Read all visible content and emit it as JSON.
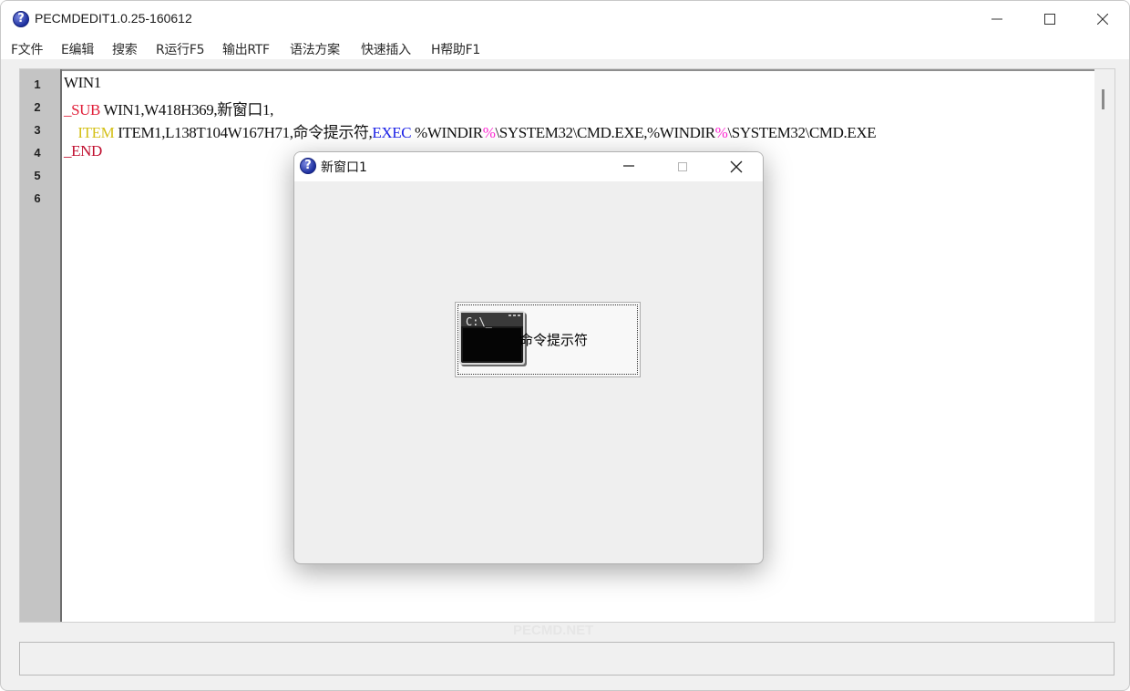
{
  "app": {
    "title": "PECMDEDIT1.0.25-160612",
    "icon_glyph": "?"
  },
  "menu": [
    {
      "label": "F文件"
    },
    {
      "label": "E编辑"
    },
    {
      "label": "搜索"
    },
    {
      "label": "R运行F5"
    },
    {
      "label": "输出RTF"
    },
    {
      "label": "语法方案"
    },
    {
      "label": "快速插入"
    },
    {
      "label": "H帮助F1"
    }
  ],
  "editor": {
    "line_numbers": [
      "1",
      "2",
      "3",
      "4",
      "5",
      "6"
    ],
    "lines": [
      {
        "parts": [
          {
            "t": "WIN1",
            "c": ""
          }
        ]
      },
      {
        "parts": [
          {
            "t": "_SUB",
            "c": "kw-red"
          },
          {
            "t": " WIN1,W418H369,新窗口1,",
            "c": ""
          }
        ]
      },
      {
        "parts": [
          {
            "t": "    ITEM",
            "c": "kw-yellow"
          },
          {
            "t": " ITEM1,L138T104W167H71,命令提示符,",
            "c": ""
          },
          {
            "t": "EXEC",
            "c": "kw-blue"
          },
          {
            "t": " %WINDIR",
            "c": ""
          },
          {
            "t": "%",
            "c": "kw-magenta"
          },
          {
            "t": "\\SYSTEM32\\CMD.EXE,%WINDIR",
            "c": ""
          },
          {
            "t": "%",
            "c": "kw-magenta"
          },
          {
            "t": "\\SYSTEM32\\CMD.EXE",
            "c": ""
          }
        ]
      },
      {
        "parts": [
          {
            "t": "_END",
            "c": "kw-darkred"
          }
        ]
      }
    ]
  },
  "watermark": "PECMD.NET",
  "preview_window": {
    "title": "新窗口1",
    "icon_glyph": "?",
    "button_label": "命令提示符",
    "cmd_icon_text": "C:\\_"
  },
  "colors": {
    "keyword_red": "#e0203a",
    "keyword_yellow": "#d4c017",
    "keyword_blue": "#1c22e8",
    "keyword_magenta": "#ff2ad4"
  }
}
